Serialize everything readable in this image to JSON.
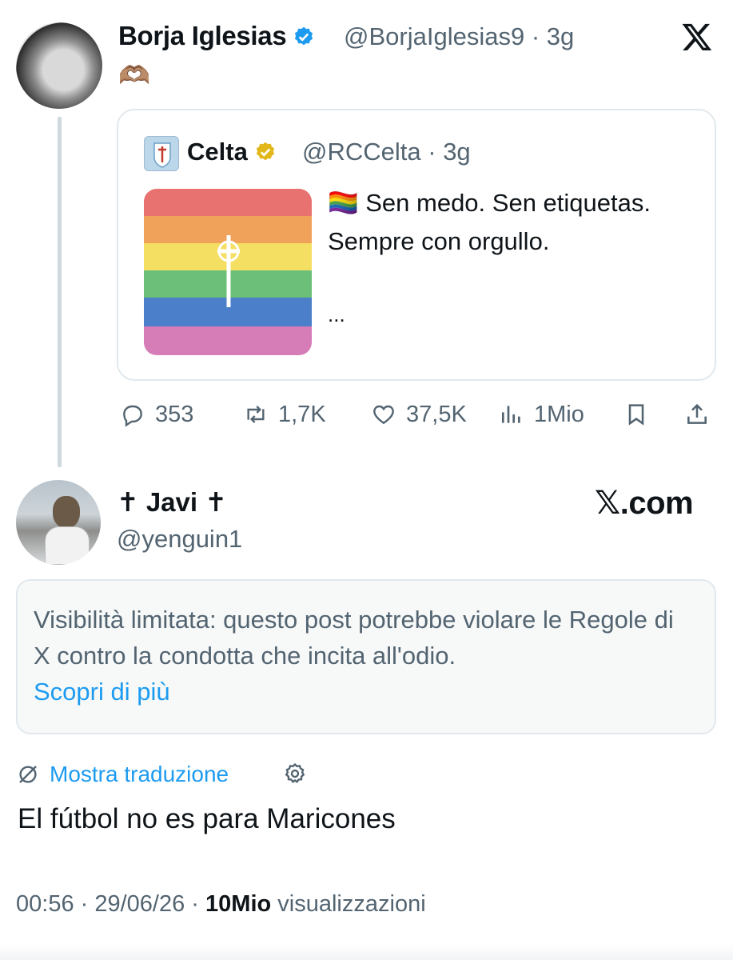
{
  "tweet": {
    "author_name": "Borja Iglesias",
    "author_handle": "@BorjaIglesias9",
    "time": "3g",
    "emoji": "🫶🏽",
    "quote": {
      "author_name": "Celta",
      "author_handle": "@RCCelta",
      "time": "3g",
      "emoji": "🏳️‍🌈",
      "text": "Sen medo. Sen etiquetas. Sempre con orgullo.",
      "ellipsis": "..."
    },
    "actions": {
      "replies": "353",
      "reposts": "1,7K",
      "likes": "37,5K",
      "views": "1Mio"
    }
  },
  "reply": {
    "author_name": "✝ Javi ✝",
    "author_handle": "@yenguin1",
    "watermark": "𝕏.com",
    "notice": {
      "text": "Visibilità limitata: questo post potrebbe violare le Regole di X contro la condotta che incita all'odio.",
      "link": "Scopri di più"
    },
    "translate_label": "Mostra traduzione",
    "text": "El fútbol no es para Maricones",
    "time": "00:56",
    "date": "29/06/26",
    "views_count": "10Mio",
    "views_label": "visualizzazioni"
  },
  "icons": {
    "reply": "speech-bubble-icon",
    "repost": "repost-arrows-icon",
    "like": "heart-icon",
    "views": "bar-chart-icon",
    "bookmark": "bookmark-icon",
    "share": "share-upload-icon",
    "translate": "globe-slash-icon",
    "settings": "gear-icon"
  },
  "colors": {
    "link": "#1d9bf0",
    "secondary_text": "#536471",
    "verified_blue": "#1d9bf0",
    "verified_gold": "#e2b719"
  }
}
